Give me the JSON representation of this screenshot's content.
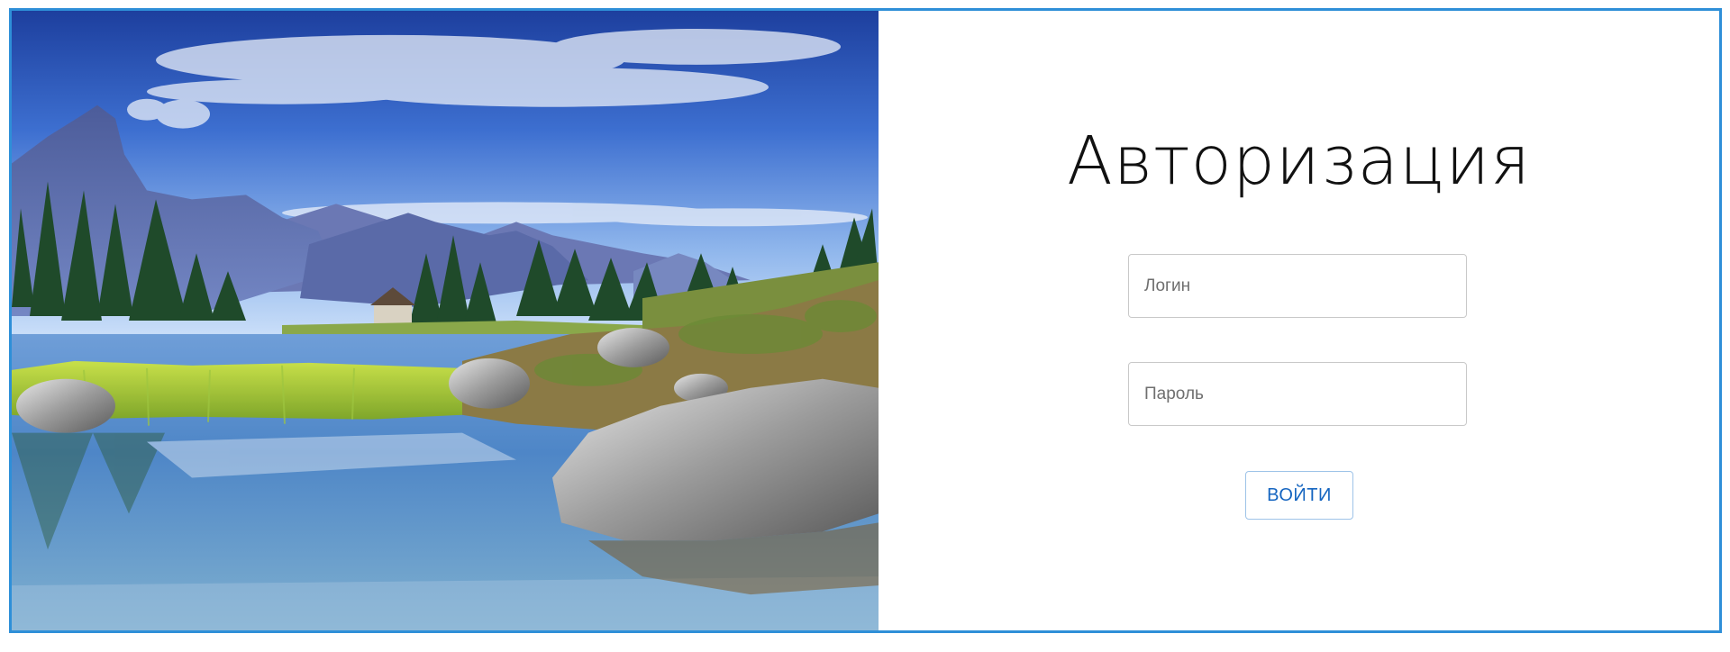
{
  "login_form": {
    "title": "Авторизация",
    "login_placeholder": "Логин",
    "password_placeholder": "Пароль",
    "submit_label": "ВОЙТИ"
  },
  "hero_image": {
    "icon": "mountain-lake-landscape-image"
  },
  "colors": {
    "frame_border": "#2e8fd8",
    "button_text": "#1565c0",
    "button_border": "#9ec3e8",
    "title_text": "#111111"
  }
}
